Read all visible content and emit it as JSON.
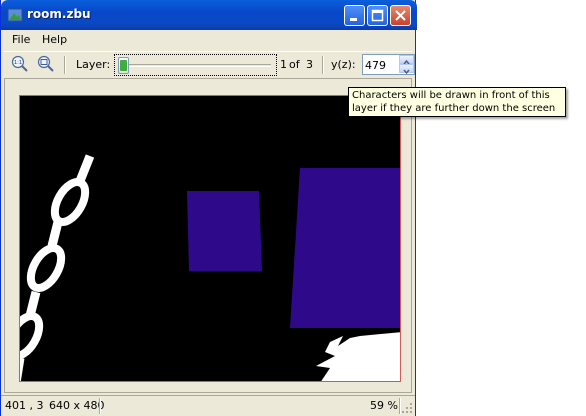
{
  "window": {
    "title": "room.zbu"
  },
  "menu": {
    "file": "File",
    "help": "Help"
  },
  "toolbar": {
    "zoom_actual_icon": "zoom-actual-size-icon",
    "zoom_fit_icon": "zoom-fit-icon",
    "layer_label": "Layer:",
    "layer_current": "1",
    "layer_of": "of",
    "layer_total": "3",
    "yz_label": "y(z):",
    "yz_value": "479"
  },
  "tooltip": {
    "text": "Characters will be drawn in front of this layer if they are further down the screen than y(z)."
  },
  "status": {
    "coords": "401 , 3",
    "size": "640 x 480",
    "zoom": "59 %"
  },
  "colors": {
    "titlebar": "#0a5fdc",
    "canvas_bg": "#000000",
    "shape_fill": "#2e0a8a",
    "tooltip_bg": "#ffffe1"
  }
}
